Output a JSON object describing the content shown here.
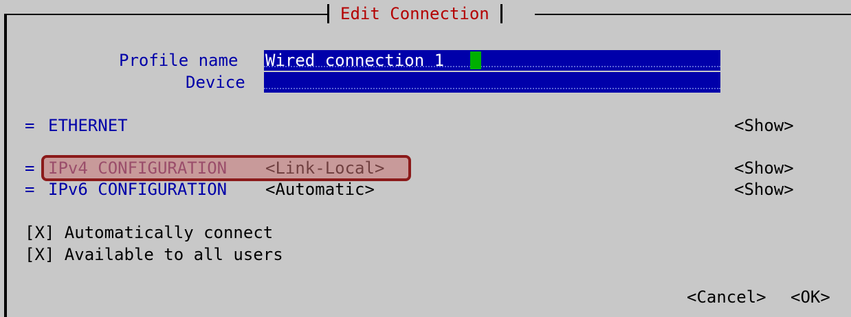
{
  "dialog": {
    "title": "Edit Connection"
  },
  "profile": {
    "label": "Profile name",
    "value": "Wired connection 1"
  },
  "device": {
    "label": "Device",
    "value": ""
  },
  "sections": {
    "ethernet": {
      "marker": "=",
      "label": "ETHERNET",
      "show": "<Show>"
    },
    "ipv4": {
      "marker": "=",
      "label": "IPv4 CONFIGURATION",
      "mode": "<Link-Local>",
      "show": "<Show>"
    },
    "ipv6": {
      "marker": "=",
      "label": "IPv6 CONFIGURATION",
      "mode": "<Automatic>",
      "show": "<Show>"
    }
  },
  "options": {
    "auto_connect": "[X] Automatically connect",
    "all_users": "[X] Available to all users"
  },
  "buttons": {
    "cancel": "<Cancel>",
    "ok": "<OK>"
  },
  "colors": {
    "background": "#c8c8c8",
    "title": "#b40000",
    "label": "#0000a8",
    "field_bg": "#0000aa",
    "cursor": "#00b000",
    "highlight_border": "#8b1a1a"
  }
}
